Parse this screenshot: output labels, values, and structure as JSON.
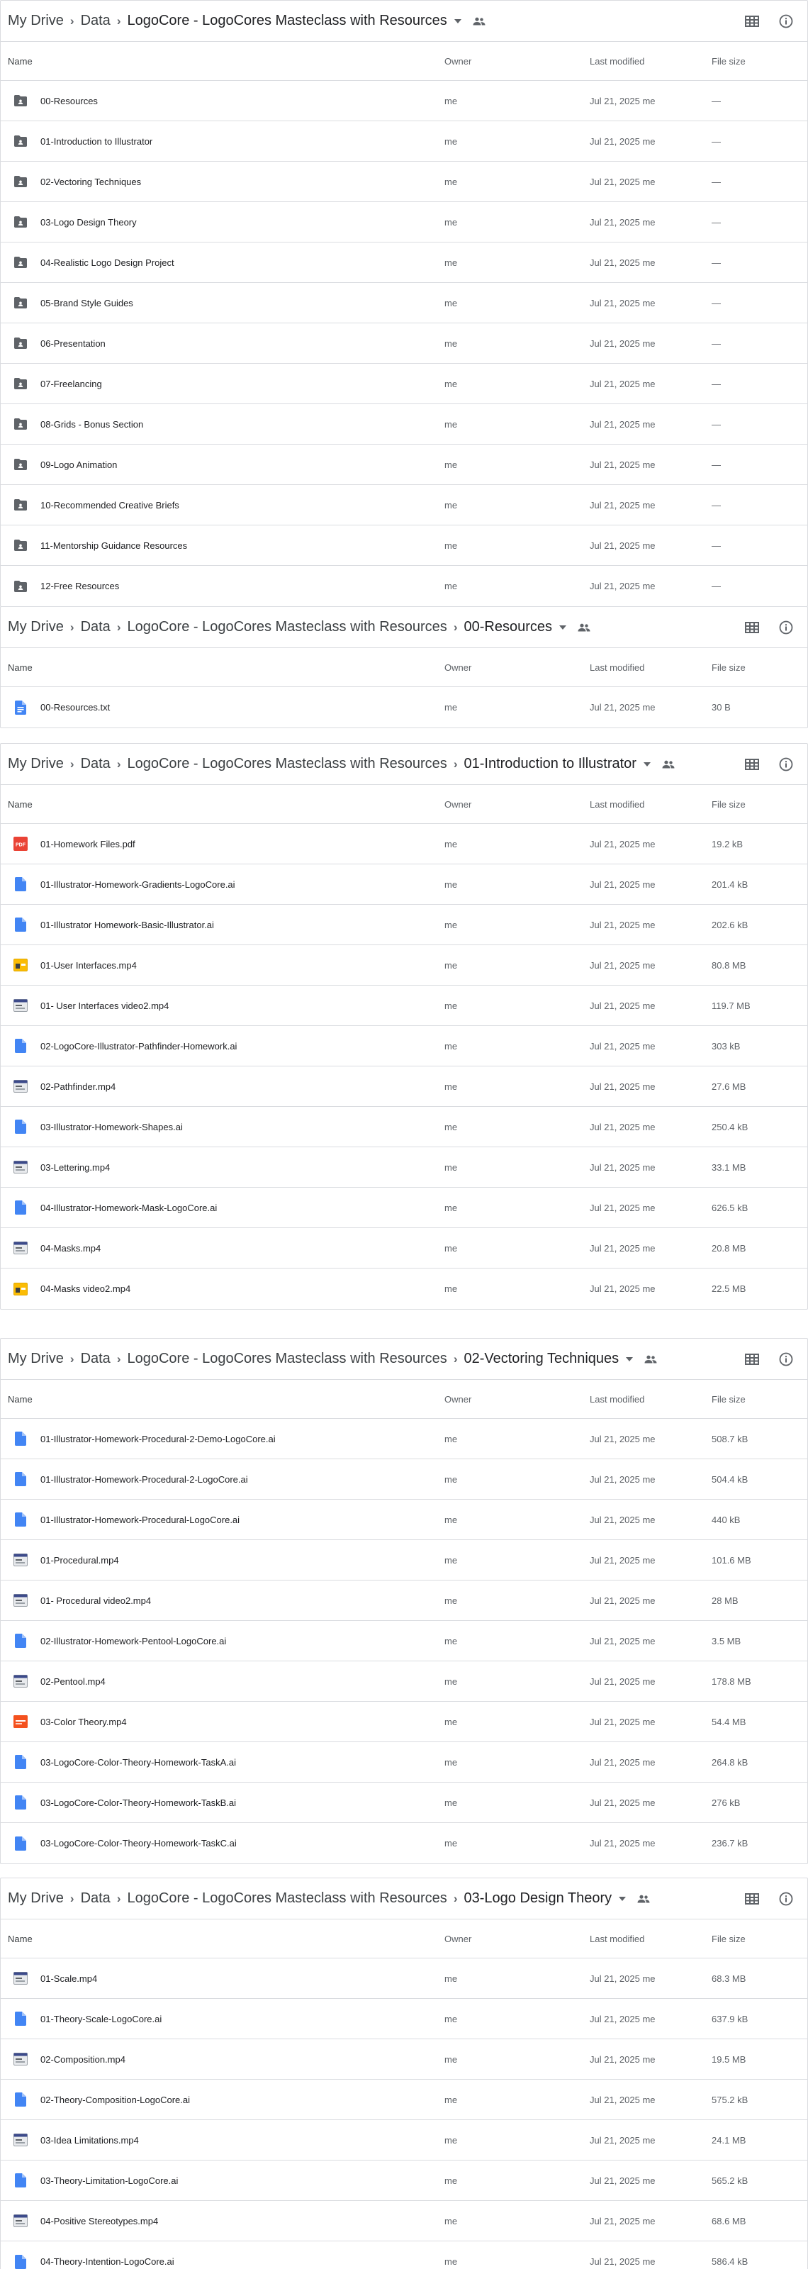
{
  "columns": {
    "name": "Name",
    "owner": "Owner",
    "modified": "Last modified",
    "size": "File size"
  },
  "panels": [
    {
      "crumbs": [
        "My Drive",
        "Data",
        "LogoCore - LogoCores Masteclass with Resources"
      ],
      "rows": [
        {
          "name": "00-Resources",
          "type": "folder",
          "owner": "me",
          "modified": "Jul 21, 2025 me",
          "size": "—"
        },
        {
          "name": "01-Introduction to Illustrator",
          "type": "folder",
          "owner": "me",
          "modified": "Jul 21, 2025 me",
          "size": "—"
        },
        {
          "name": "02-Vectoring Techniques",
          "type": "folder",
          "owner": "me",
          "modified": "Jul 21, 2025 me",
          "size": "—"
        },
        {
          "name": "03-Logo Design Theory",
          "type": "folder",
          "owner": "me",
          "modified": "Jul 21, 2025 me",
          "size": "—"
        },
        {
          "name": "04-Realistic Logo Design Project",
          "type": "folder",
          "owner": "me",
          "modified": "Jul 21, 2025 me",
          "size": "—"
        },
        {
          "name": "05-Brand Style Guides",
          "type": "folder",
          "owner": "me",
          "modified": "Jul 21, 2025 me",
          "size": "—"
        },
        {
          "name": "06-Presentation",
          "type": "folder",
          "owner": "me",
          "modified": "Jul 21, 2025 me",
          "size": "—"
        },
        {
          "name": "07-Freelancing",
          "type": "folder",
          "owner": "me",
          "modified": "Jul 21, 2025 me",
          "size": "—"
        },
        {
          "name": "08-Grids - Bonus Section",
          "type": "folder",
          "owner": "me",
          "modified": "Jul 21, 2025 me",
          "size": "—"
        },
        {
          "name": "09-Logo Animation",
          "type": "folder",
          "owner": "me",
          "modified": "Jul 21, 2025 me",
          "size": "—"
        },
        {
          "name": "10-Recommended Creative Briefs",
          "type": "folder",
          "owner": "me",
          "modified": "Jul 21, 2025 me",
          "size": "—"
        },
        {
          "name": "11-Mentorship Guidance Resources",
          "type": "folder",
          "owner": "me",
          "modified": "Jul 21, 2025 me",
          "size": "—"
        },
        {
          "name": "12-Free Resources",
          "type": "folder",
          "owner": "me",
          "modified": "Jul 21, 2025 me",
          "size": "—"
        }
      ]
    },
    {
      "crumbs": [
        "My Drive",
        "Data",
        "LogoCore - LogoCores Masteclass with Resources",
        "00-Resources"
      ],
      "rows": [
        {
          "name": "00-Resources.txt",
          "type": "doc",
          "owner": "me",
          "modified": "Jul 21, 2025 me",
          "size": "30 B"
        }
      ]
    },
    {
      "crumbs": [
        "My Drive",
        "Data",
        "LogoCore - LogoCores Masteclass with Resources",
        "01-Introduction to Illustrator"
      ],
      "rows": [
        {
          "name": "01-Homework Files.pdf",
          "type": "pdf",
          "owner": "me",
          "modified": "Jul 21, 2025 me",
          "size": "19.2 kB"
        },
        {
          "name": "01-Illustrator-Homework-Gradients-LogoCore.ai",
          "type": "file",
          "owner": "me",
          "modified": "Jul 21, 2025 me",
          "size": "201.4 kB"
        },
        {
          "name": "01-Illustrator Homework-Basic-Illustrator.ai",
          "type": "file",
          "owner": "me",
          "modified": "Jul 21, 2025 me",
          "size": "202.6 kB"
        },
        {
          "name": "01-User Interfaces.mp4",
          "type": "video-yellow",
          "owner": "me",
          "modified": "Jul 21, 2025 me",
          "size": "80.8 MB"
        },
        {
          "name": "01- User Interfaces video2.mp4",
          "type": "video",
          "owner": "me",
          "modified": "Jul 21, 2025 me",
          "size": "119.7 MB"
        },
        {
          "name": "02-LogoCore-Illustrator-Pathfinder-Homework.ai",
          "type": "file",
          "owner": "me",
          "modified": "Jul 21, 2025 me",
          "size": "303 kB"
        },
        {
          "name": "02-Pathfinder.mp4",
          "type": "video",
          "owner": "me",
          "modified": "Jul 21, 2025 me",
          "size": "27.6 MB"
        },
        {
          "name": "03-Illustrator-Homework-Shapes.ai",
          "type": "file",
          "owner": "me",
          "modified": "Jul 21, 2025 me",
          "size": "250.4 kB"
        },
        {
          "name": "03-Lettering.mp4",
          "type": "video",
          "owner": "me",
          "modified": "Jul 21, 2025 me",
          "size": "33.1 MB"
        },
        {
          "name": "04-Illustrator-Homework-Mask-LogoCore.ai",
          "type": "file",
          "owner": "me",
          "modified": "Jul 21, 2025 me",
          "size": "626.5 kB"
        },
        {
          "name": "04-Masks.mp4",
          "type": "video",
          "owner": "me",
          "modified": "Jul 21, 2025 me",
          "size": "20.8 MB"
        },
        {
          "name": "04-Masks video2.mp4",
          "type": "video-yellow",
          "owner": "me",
          "modified": "Jul 21, 2025 me",
          "size": "22.5 MB"
        }
      ]
    },
    {
      "crumbs": [
        "My Drive",
        "Data",
        "LogoCore - LogoCores Masteclass with Resources",
        "02-Vectoring Techniques"
      ],
      "rows": [
        {
          "name": "01-Illustrator-Homework-Procedural-2-Demo-LogoCore.ai",
          "type": "file",
          "owner": "me",
          "modified": "Jul 21, 2025 me",
          "size": "508.7 kB"
        },
        {
          "name": "01-Illustrator-Homework-Procedural-2-LogoCore.ai",
          "type": "file",
          "owner": "me",
          "modified": "Jul 21, 2025 me",
          "size": "504.4 kB"
        },
        {
          "name": "01-Illustrator-Homework-Procedural-LogoCore.ai",
          "type": "file",
          "owner": "me",
          "modified": "Jul 21, 2025 me",
          "size": "440 kB"
        },
        {
          "name": "01-Procedural.mp4",
          "type": "video",
          "owner": "me",
          "modified": "Jul 21, 2025 me",
          "size": "101.6 MB"
        },
        {
          "name": "01- Procedural video2.mp4",
          "type": "video",
          "owner": "me",
          "modified": "Jul 21, 2025 me",
          "size": "28 MB"
        },
        {
          "name": "02-Illustrator-Homework-Pentool-LogoCore.ai",
          "type": "file",
          "owner": "me",
          "modified": "Jul 21, 2025 me",
          "size": "3.5 MB"
        },
        {
          "name": "02-Pentool.mp4",
          "type": "video",
          "owner": "me",
          "modified": "Jul 21, 2025 me",
          "size": "178.8 MB"
        },
        {
          "name": "03-Color Theory.mp4",
          "type": "video-orange",
          "owner": "me",
          "modified": "Jul 21, 2025 me",
          "size": "54.4 MB"
        },
        {
          "name": "03-LogoCore-Color-Theory-Homework-TaskA.ai",
          "type": "file",
          "owner": "me",
          "modified": "Jul 21, 2025 me",
          "size": "264.8 kB"
        },
        {
          "name": "03-LogoCore-Color-Theory-Homework-TaskB.ai",
          "type": "file",
          "owner": "me",
          "modified": "Jul 21, 2025 me",
          "size": "276 kB"
        },
        {
          "name": "03-LogoCore-Color-Theory-Homework-TaskC.ai",
          "type": "file",
          "owner": "me",
          "modified": "Jul 21, 2025 me",
          "size": "236.7 kB"
        }
      ]
    },
    {
      "crumbs": [
        "My Drive",
        "Data",
        "LogoCore - LogoCores Masteclass with Resources",
        "03-Logo Design Theory"
      ],
      "rows": [
        {
          "name": "01-Scale.mp4",
          "type": "video",
          "owner": "me",
          "modified": "Jul 21, 2025 me",
          "size": "68.3 MB"
        },
        {
          "name": "01-Theory-Scale-LogoCore.ai",
          "type": "file",
          "owner": "me",
          "modified": "Jul 21, 2025 me",
          "size": "637.9 kB"
        },
        {
          "name": "02-Composition.mp4",
          "type": "video",
          "owner": "me",
          "modified": "Jul 21, 2025 me",
          "size": "19.5 MB"
        },
        {
          "name": "02-Theory-Composition-LogoCore.ai",
          "type": "file",
          "owner": "me",
          "modified": "Jul 21, 2025 me",
          "size": "575.2 kB"
        },
        {
          "name": "03-Idea Limitations.mp4",
          "type": "video",
          "owner": "me",
          "modified": "Jul 21, 2025 me",
          "size": "24.1 MB"
        },
        {
          "name": "03-Theory-Limitation-LogoCore.ai",
          "type": "file",
          "owner": "me",
          "modified": "Jul 21, 2025 me",
          "size": "565.2 kB"
        },
        {
          "name": "04-Positive Stereotypes.mp4",
          "type": "video",
          "owner": "me",
          "modified": "Jul 21, 2025 me",
          "size": "68.6 MB"
        },
        {
          "name": "04-Theory-Intention-LogoCore.ai",
          "type": "file",
          "owner": "me",
          "modified": "Jul 21, 2025 me",
          "size": "586.4 kB"
        }
      ]
    }
  ]
}
